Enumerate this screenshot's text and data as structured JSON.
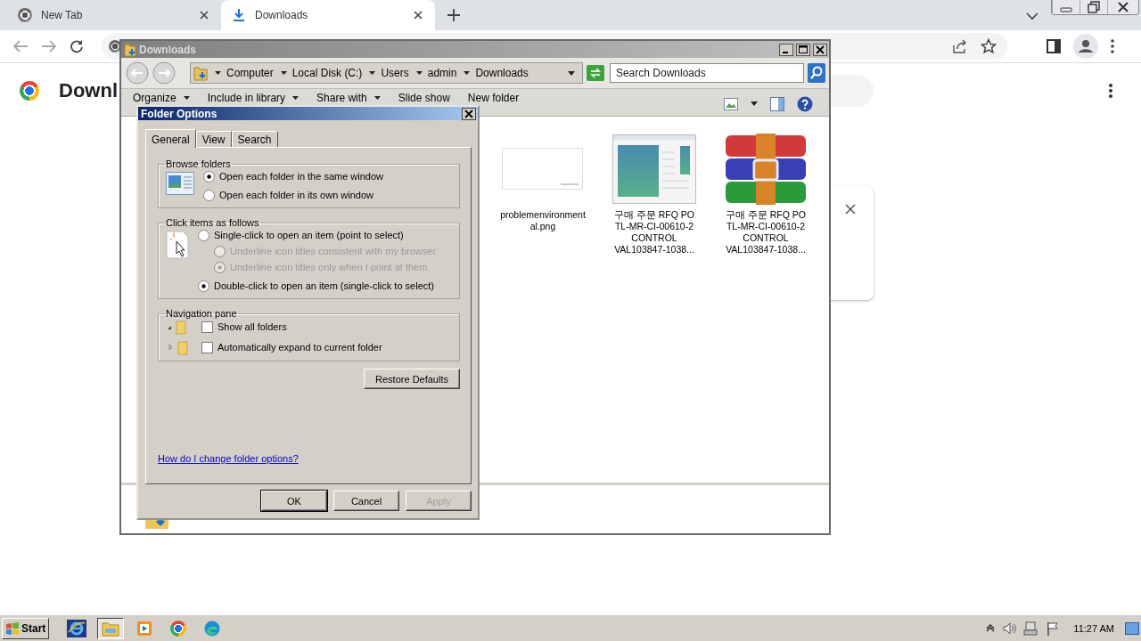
{
  "browser": {
    "tabs": [
      {
        "title": "New Tab",
        "kind": "newtab",
        "selected": false
      },
      {
        "title": "Downloads",
        "kind": "downloads",
        "selected": true
      }
    ],
    "page": {
      "heading": "Downl"
    }
  },
  "explorer": {
    "title": "Downloads",
    "breadcrumb": [
      "Computer",
      "Local Disk (C:)",
      "Users",
      "admin",
      "Downloads"
    ],
    "search": {
      "placeholder": "Search Downloads"
    },
    "toolbar": [
      {
        "label": "Organize",
        "dropdown": true
      },
      {
        "label": "Include in library",
        "dropdown": true
      },
      {
        "label": "Share with",
        "dropdown": true
      },
      {
        "label": "Slide show",
        "dropdown": false
      },
      {
        "label": "New folder",
        "dropdown": false
      }
    ],
    "files": [
      {
        "name": "problemenvironmental.png",
        "kind": "image"
      },
      {
        "name": "구매 주문 RFQ PO TL-MR-CI-00610-2 CONTROL VAL103847-1038...",
        "kind": "document"
      },
      {
        "name": "구매 주문 RFQ PO TL-MR-CI-00610-2 CONTROL VAL103847-1038...",
        "kind": "archive"
      }
    ]
  },
  "dialog": {
    "title": "Folder Options",
    "tabs": [
      {
        "label": "General",
        "selected": true
      },
      {
        "label": "View",
        "selected": false
      },
      {
        "label": "Search",
        "selected": false
      }
    ],
    "groups": [
      {
        "title": "Browse folders",
        "kind": "browse",
        "options": [
          {
            "kind": "radio",
            "label": "Open each folder in the same window",
            "selected": true,
            "disabled": false
          },
          {
            "kind": "radio",
            "label": "Open each folder in its own window",
            "selected": false,
            "disabled": false
          }
        ]
      },
      {
        "title": "Click items as follows",
        "kind": "click",
        "options": [
          {
            "kind": "radio",
            "label": "Single-click to open an item (point to select)",
            "selected": false,
            "disabled": false,
            "children": [
              {
                "kind": "radio",
                "label": "Underline icon titles consistent with my browser",
                "selected": false,
                "disabled": true
              },
              {
                "kind": "radio",
                "label": "Underline icon titles only when I point at them",
                "selected": true,
                "disabled": true
              }
            ]
          },
          {
            "kind": "radio",
            "label": "Double-click to open an item (single-click to select)",
            "selected": true,
            "disabled": false
          }
        ]
      },
      {
        "title": "Navigation pane",
        "kind": "nav",
        "options": [
          {
            "kind": "checkbox",
            "label": "Show all folders",
            "checked": false,
            "expanded": true
          },
          {
            "kind": "checkbox",
            "label": "Automatically expand to current folder",
            "checked": false,
            "expanded": false
          }
        ]
      }
    ],
    "restore_button": "Restore Defaults",
    "help_link": "How do I change folder options?",
    "buttons": [
      {
        "label": "OK",
        "default": true,
        "disabled": false
      },
      {
        "label": "Cancel",
        "default": false,
        "disabled": false
      },
      {
        "label": "Apply",
        "default": false,
        "disabled": true
      }
    ]
  },
  "taskbar": {
    "start": "Start",
    "apps": [
      {
        "kind": "ie",
        "active": false
      },
      {
        "kind": "explorer",
        "active": true
      },
      {
        "kind": "media",
        "active": false
      },
      {
        "kind": "chrome",
        "active": false
      },
      {
        "kind": "edge",
        "active": false
      }
    ],
    "clock": "11:27 AM"
  }
}
